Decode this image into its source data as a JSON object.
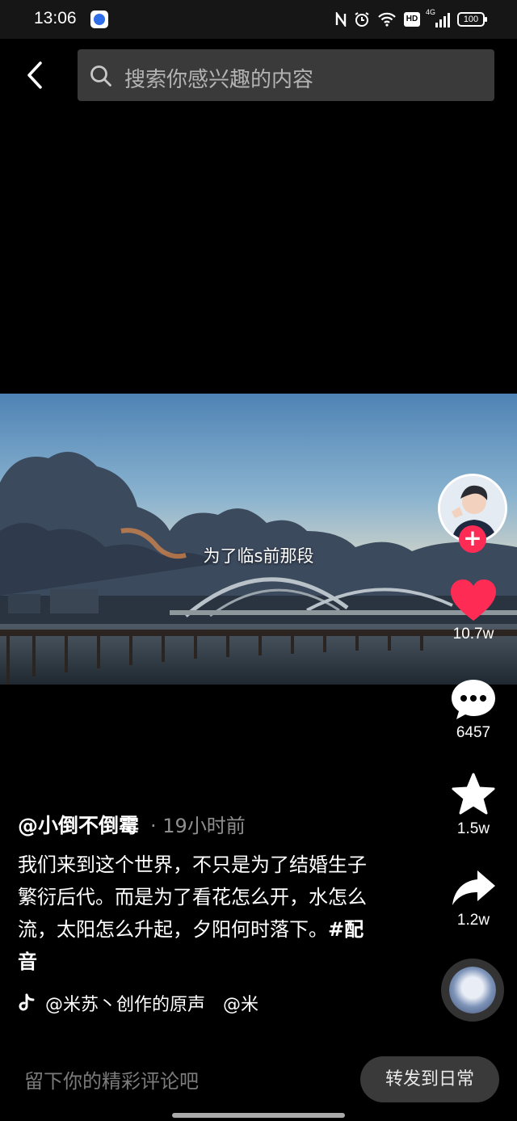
{
  "status_bar": {
    "time": "13:06",
    "battery": "100",
    "network": "4G",
    "hd": "HD",
    "icons": [
      "nfc-icon",
      "alarm-icon",
      "wifi-icon",
      "hd-icon",
      "signal-icon",
      "battery-icon"
    ]
  },
  "header": {
    "search_placeholder": "搜索你感兴趣的内容"
  },
  "video": {
    "subtitle": "为了临s前那段"
  },
  "rail": {
    "likes": "10.7w",
    "comments": "6457",
    "favorites": "1.5w",
    "shares": "1.2w"
  },
  "post": {
    "author": "@小倒不倒霉",
    "time": "· 19小时前",
    "description": "我们来到这个世界，不只是为了结婚生子繁衍后代。而是为了看花怎么开，水怎么流，太阳怎么升起，夕阳何时落下。",
    "hashtag": "#配音",
    "music": "@米苏丶创作的原声　@米"
  },
  "bottom": {
    "comment_placeholder": "留下你的精彩评论吧",
    "share_daily": "转发到日常"
  },
  "colors": {
    "like": "#fe2c55",
    "follow": "#fe2c55",
    "search_bg": "#3a3a3a",
    "background": "#000000"
  }
}
